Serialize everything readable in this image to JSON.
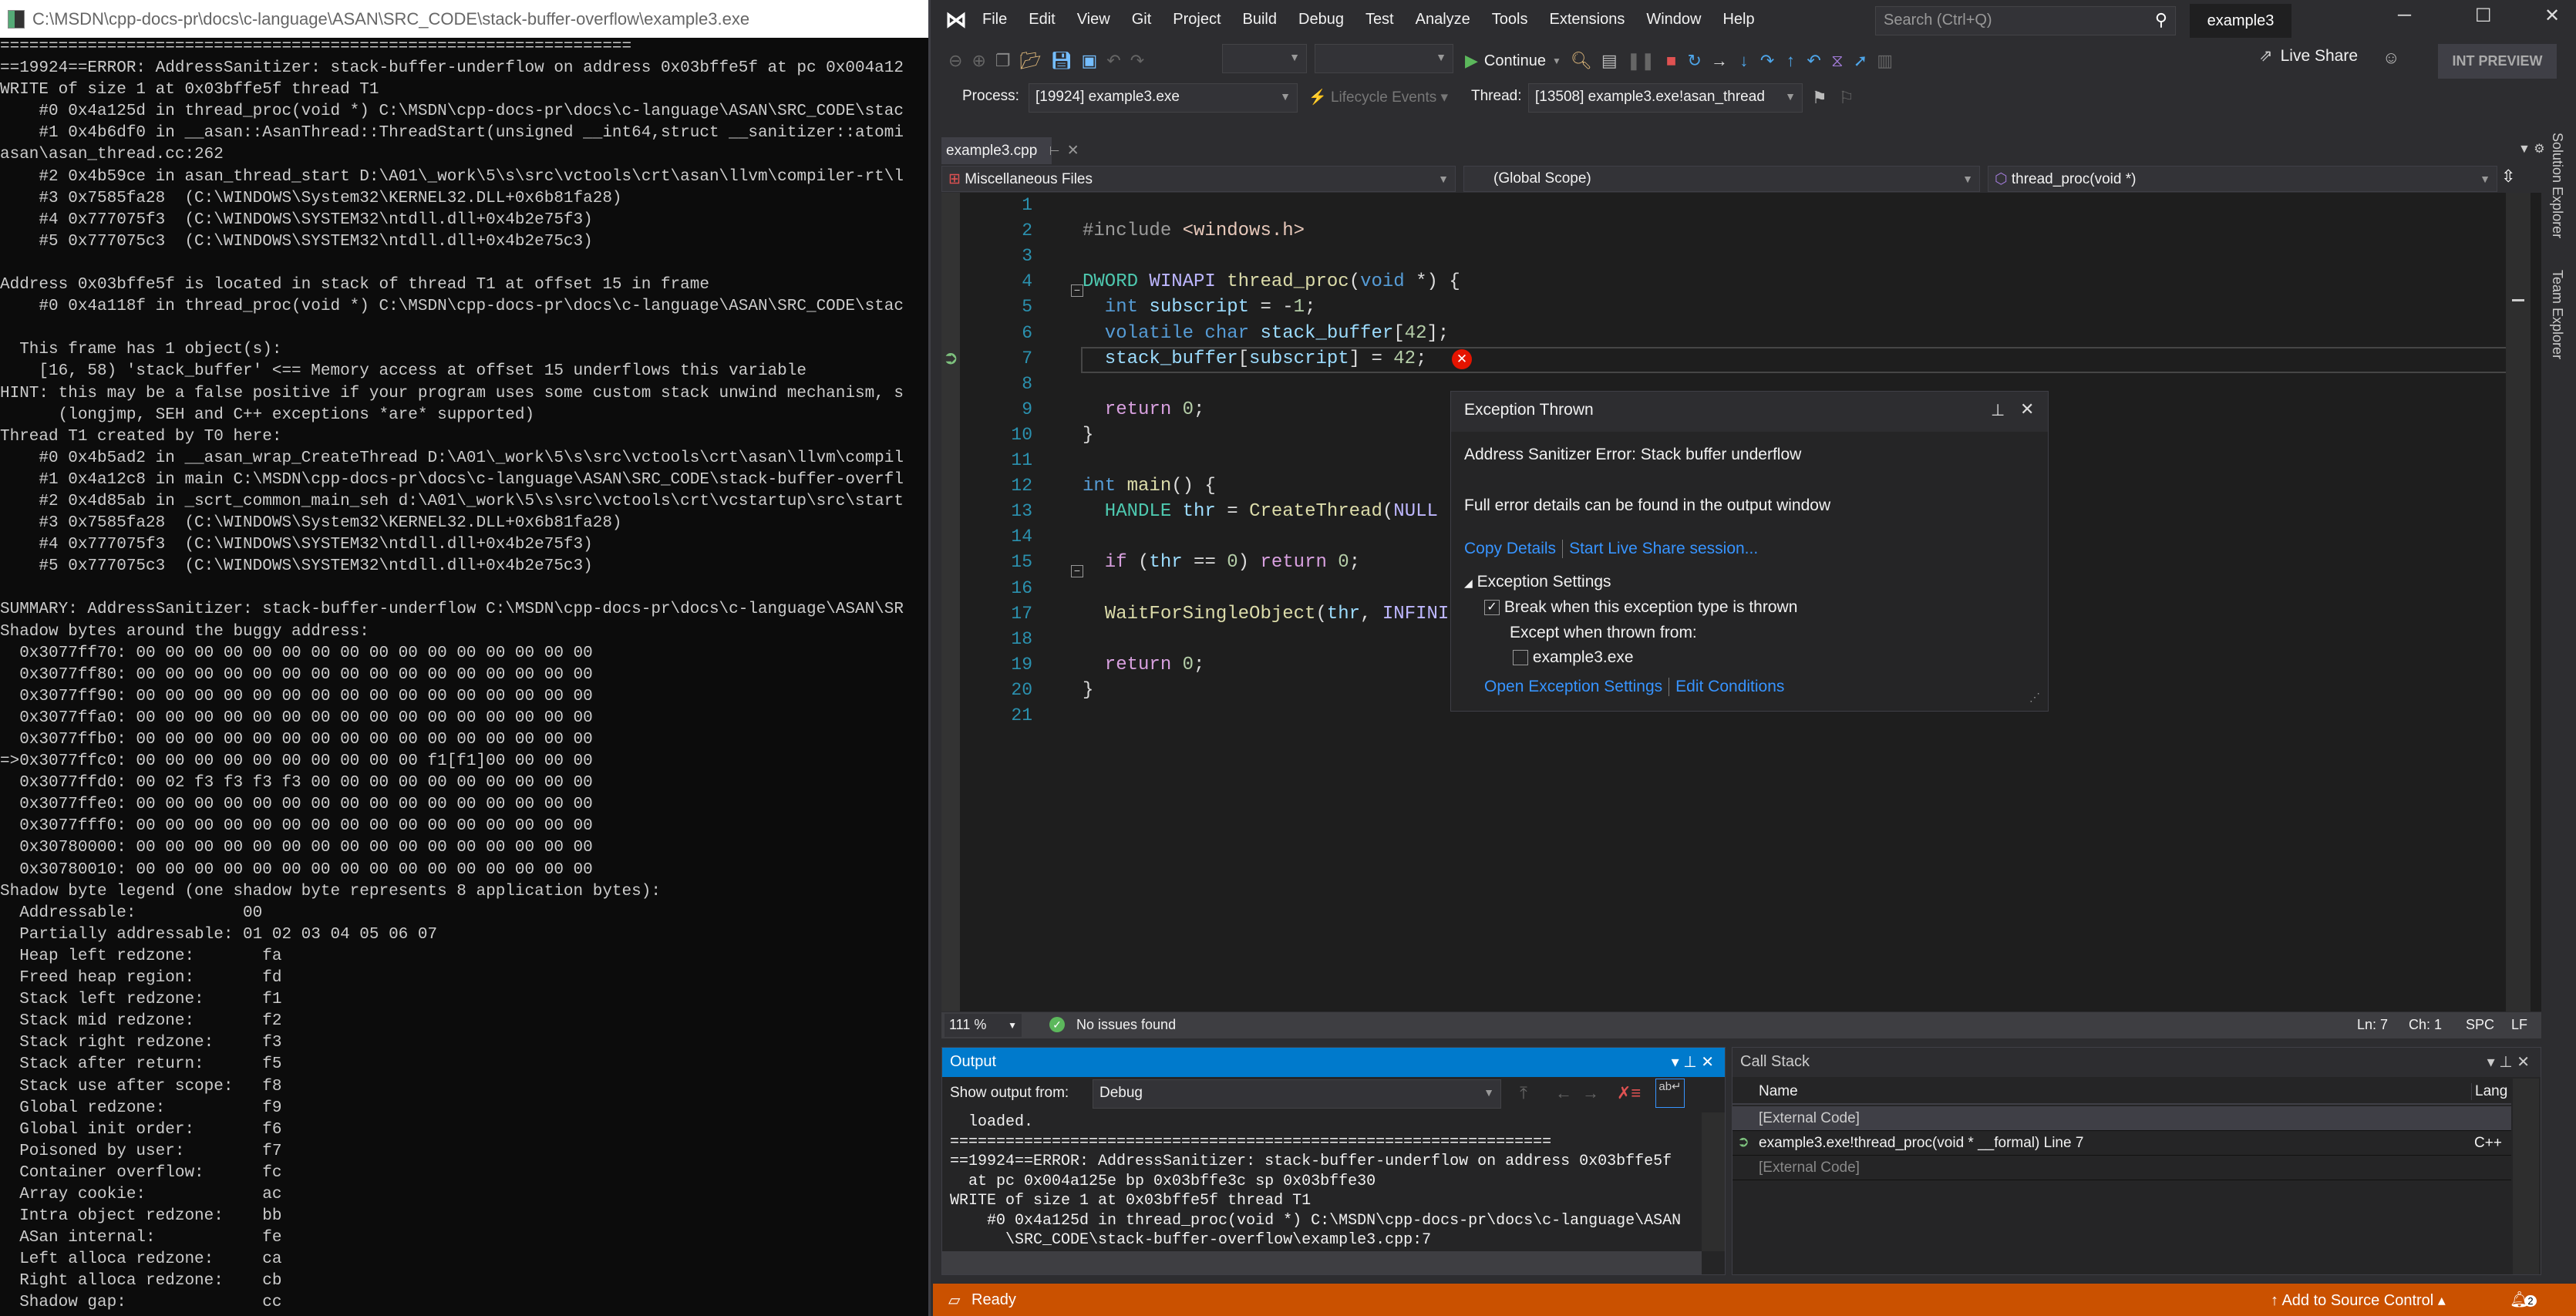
{
  "console": {
    "title": "C:\\MSDN\\cpp-docs-pr\\docs\\c-language\\ASAN\\SRC_CODE\\stack-buffer-overflow\\example3.exe",
    "lines": [
      "=================================================================",
      "==19924==ERROR: AddressSanitizer: stack-buffer-underflow on address 0x03bffe5f at pc 0x004a12",
      "WRITE of size 1 at 0x03bffe5f thread T1",
      "    #0 0x4a125d in thread_proc(void *) C:\\MSDN\\cpp-docs-pr\\docs\\c-language\\ASAN\\SRC_CODE\\stac",
      "    #1 0x4b6df0 in __asan::AsanThread::ThreadStart(unsigned __int64,struct __sanitizer::atomi",
      "asan\\asan_thread.cc:262",
      "    #2 0x4b59ce in asan_thread_start D:\\A01\\_work\\5\\s\\src\\vctools\\crt\\asan\\llvm\\compiler-rt\\l",
      "    #3 0x7585fa28  (C:\\WINDOWS\\System32\\KERNEL32.DLL+0x6b81fa28)",
      "    #4 0x777075f3  (C:\\WINDOWS\\SYSTEM32\\ntdll.dll+0x4b2e75f3)",
      "    #5 0x777075c3  (C:\\WINDOWS\\SYSTEM32\\ntdll.dll+0x4b2e75c3)",
      "",
      "Address 0x03bffe5f is located in stack of thread T1 at offset 15 in frame",
      "    #0 0x4a118f in thread_proc(void *) C:\\MSDN\\cpp-docs-pr\\docs\\c-language\\ASAN\\SRC_CODE\\stac",
      "",
      "  This frame has 1 object(s):",
      "    [16, 58) 'stack_buffer' <== Memory access at offset 15 underflows this variable",
      "HINT: this may be a false positive if your program uses some custom stack unwind mechanism, s",
      "      (longjmp, SEH and C++ exceptions *are* supported)",
      "Thread T1 created by T0 here:",
      "    #0 0x4b5ad2 in __asan_wrap_CreateThread D:\\A01\\_work\\5\\s\\src\\vctools\\crt\\asan\\llvm\\compil",
      "    #1 0x4a12c8 in main C:\\MSDN\\cpp-docs-pr\\docs\\c-language\\ASAN\\SRC_CODE\\stack-buffer-overfl",
      "    #2 0x4d85ab in _scrt_common_main_seh d:\\A01\\_work\\5\\s\\src\\vctools\\crt\\vcstartup\\src\\start",
      "    #3 0x7585fa28  (C:\\WINDOWS\\System32\\KERNEL32.DLL+0x6b81fa28)",
      "    #4 0x777075f3  (C:\\WINDOWS\\SYSTEM32\\ntdll.dll+0x4b2e75f3)",
      "    #5 0x777075c3  (C:\\WINDOWS\\SYSTEM32\\ntdll.dll+0x4b2e75c3)",
      "",
      "SUMMARY: AddressSanitizer: stack-buffer-underflow C:\\MSDN\\cpp-docs-pr\\docs\\c-language\\ASAN\\SR",
      "Shadow bytes around the buggy address:",
      "  0x3077ff70: 00 00 00 00 00 00 00 00 00 00 00 00 00 00 00 00",
      "  0x3077ff80: 00 00 00 00 00 00 00 00 00 00 00 00 00 00 00 00",
      "  0x3077ff90: 00 00 00 00 00 00 00 00 00 00 00 00 00 00 00 00",
      "  0x3077ffa0: 00 00 00 00 00 00 00 00 00 00 00 00 00 00 00 00",
      "  0x3077ffb0: 00 00 00 00 00 00 00 00 00 00 00 00 00 00 00 00",
      "=>0x3077ffc0: 00 00 00 00 00 00 00 00 00 00 f1[f1]00 00 00 00",
      "  0x3077ffd0: 00 02 f3 f3 f3 f3 00 00 00 00 00 00 00 00 00 00",
      "  0x3077ffe0: 00 00 00 00 00 00 00 00 00 00 00 00 00 00 00 00",
      "  0x3077fff0: 00 00 00 00 00 00 00 00 00 00 00 00 00 00 00 00",
      "  0x30780000: 00 00 00 00 00 00 00 00 00 00 00 00 00 00 00 00",
      "  0x30780010: 00 00 00 00 00 00 00 00 00 00 00 00 00 00 00 00",
      "Shadow byte legend (one shadow byte represents 8 application bytes):",
      "  Addressable:           00",
      "  Partially addressable: 01 02 03 04 05 06 07",
      "  Heap left redzone:       fa",
      "  Freed heap region:       fd",
      "  Stack left redzone:      f1",
      "  Stack mid redzone:       f2",
      "  Stack right redzone:     f3",
      "  Stack after return:      f5",
      "  Stack use after scope:   f8",
      "  Global redzone:          f9",
      "  Global init order:       f6",
      "  Poisoned by user:        f7",
      "  Container overflow:      fc",
      "  Array cookie:            ac",
      "  Intra object redzone:    bb",
      "  ASan internal:           fe",
      "  Left alloca redzone:     ca",
      "  Right alloca redzone:    cb",
      "  Shadow gap:              cc"
    ]
  },
  "vs": {
    "menu": [
      "File",
      "Edit",
      "View",
      "Git",
      "Project",
      "Build",
      "Debug",
      "Test",
      "Analyze",
      "Tools",
      "Extensions",
      "Window",
      "Help"
    ],
    "search_placeholder": "Search (Ctrl+Q)",
    "window_title": "example3",
    "toolbar": {
      "continue_label": "Continue",
      "live_share": "Live Share",
      "int_preview": "INT PREVIEW"
    },
    "debug_location": {
      "process_label": "Process:",
      "process_value": "[19924] example3.exe",
      "lifecycle_label": "Lifecycle Events",
      "thread_label": "Thread:",
      "thread_value": "[13508] example3.exe!asan_thread"
    },
    "doc_tab": "example3.cpp",
    "nav": {
      "project": "Miscellaneous Files",
      "scope": "(Global Scope)",
      "member": "thread_proc(void *)"
    },
    "side_tabs": [
      "Solution Explorer",
      "Team Explorer"
    ],
    "accent": "#007acc",
    "status_color": "#ca5100"
  },
  "editor": {
    "line_numbers": [
      "1",
      "2",
      "3",
      "4",
      "5",
      "6",
      "7",
      "8",
      "9",
      "10",
      "11",
      "12",
      "13",
      "14",
      "15",
      "16",
      "17",
      "18",
      "19",
      "20",
      "21"
    ],
    "current_line": 7,
    "lines": [
      [],
      [
        {
          "t": "#include ",
          "k": "pp"
        },
        {
          "t": "<windows.h>",
          "k": "str"
        }
      ],
      [],
      [
        {
          "t": "DWORD ",
          "k": "ty"
        },
        {
          "t": "WINAPI ",
          "k": "mac"
        },
        {
          "t": "thread_proc",
          "k": "fn"
        },
        {
          "t": "(",
          "k": "p"
        },
        {
          "t": "void",
          "k": "kw"
        },
        {
          "t": " *) {",
          "k": "p"
        }
      ],
      [
        {
          "t": "  int ",
          "k": "kw"
        },
        {
          "t": "subscript",
          "k": "var"
        },
        {
          "t": " = -",
          "k": "p"
        },
        {
          "t": "1",
          "k": "num"
        },
        {
          "t": ";",
          "k": "p"
        }
      ],
      [
        {
          "t": "  volatile char ",
          "k": "kw"
        },
        {
          "t": "stack_buffer",
          "k": "var"
        },
        {
          "t": "[",
          "k": "p"
        },
        {
          "t": "42",
          "k": "num"
        },
        {
          "t": "];",
          "k": "p"
        }
      ],
      [
        {
          "t": "  stack_buffer",
          "k": "var"
        },
        {
          "t": "[",
          "k": "p"
        },
        {
          "t": "subscript",
          "k": "var"
        },
        {
          "t": "] = ",
          "k": "p"
        },
        {
          "t": "42",
          "k": "num"
        },
        {
          "t": ";",
          "k": "p"
        }
      ],
      [],
      [
        {
          "t": "  return ",
          "k": "ctl"
        },
        {
          "t": "0",
          "k": "num"
        },
        {
          "t": ";",
          "k": "p"
        }
      ],
      [
        {
          "t": "}",
          "k": "p"
        }
      ],
      [],
      [
        {
          "t": "int ",
          "k": "kw"
        },
        {
          "t": "main",
          "k": "fn"
        },
        {
          "t": "() {",
          "k": "p"
        }
      ],
      [
        {
          "t": "  HANDLE ",
          "k": "ty"
        },
        {
          "t": "thr",
          "k": "var"
        },
        {
          "t": " = ",
          "k": "p"
        },
        {
          "t": "CreateThread",
          "k": "fn"
        },
        {
          "t": "(",
          "k": "p"
        },
        {
          "t": "NULL",
          "k": "mac"
        }
      ],
      [],
      [
        {
          "t": "  if ",
          "k": "ctl"
        },
        {
          "t": "(",
          "k": "p"
        },
        {
          "t": "thr",
          "k": "var"
        },
        {
          "t": " == ",
          "k": "p"
        },
        {
          "t": "0",
          "k": "num"
        },
        {
          "t": ") ",
          "k": "p"
        },
        {
          "t": "return ",
          "k": "ctl"
        },
        {
          "t": "0",
          "k": "num"
        },
        {
          "t": ";",
          "k": "p"
        }
      ],
      [],
      [
        {
          "t": "  WaitForSingleObject",
          "k": "fn"
        },
        {
          "t": "(",
          "k": "p"
        },
        {
          "t": "thr",
          "k": "var"
        },
        {
          "t": ", ",
          "k": "p"
        },
        {
          "t": "INFINI",
          "k": "mac"
        }
      ],
      [],
      [
        {
          "t": "  return ",
          "k": "ctl"
        },
        {
          "t": "0",
          "k": "num"
        },
        {
          "t": ";",
          "k": "p"
        }
      ],
      [
        {
          "t": "}",
          "k": "p"
        }
      ],
      []
    ]
  },
  "exception_popup": {
    "title": "Exception Thrown",
    "message": "Address Sanitizer Error: Stack buffer underflow",
    "detail": "Full error details can be found in the output window",
    "copy_details": "Copy Details",
    "live_share": "Start Live Share session...",
    "settings_header": "Exception Settings",
    "break_label": "Break when this exception type is thrown",
    "break_checked": true,
    "except_label": "Except when thrown from:",
    "module_label": "example3.exe",
    "module_checked": false,
    "open_settings": "Open Exception Settings",
    "edit_conditions": "Edit Conditions"
  },
  "editor_status": {
    "zoom": "111 %",
    "issues": "No issues found",
    "ln": "Ln: 7",
    "ch": "Ch: 1",
    "spc": "SPC",
    "lf": "LF"
  },
  "output": {
    "title": "Output",
    "show_from_label": "Show output from:",
    "source": "Debug",
    "lines": [
      "  loaded.",
      "=================================================================",
      "==19924==ERROR: AddressSanitizer: stack-buffer-underflow on address 0x03bffe5f",
      "  at pc 0x004a125e bp 0x03bffe3c sp 0x03bffe30",
      "WRITE of size 1 at 0x03bffe5f thread T1",
      "    #0 0x4a125d in thread_proc(void *) C:\\MSDN\\cpp-docs-pr\\docs\\c-language\\ASAN",
      "      \\SRC_CODE\\stack-buffer-overflow\\example3.cpp:7"
    ]
  },
  "call_stack": {
    "title": "Call Stack",
    "columns": [
      "Name",
      "Lang"
    ],
    "rows": [
      {
        "name": "[External Code]",
        "lang": ""
      },
      {
        "name": "example3.exe!thread_proc(void * __formal) Line 7",
        "lang": "C++"
      },
      {
        "name": "[External Code]",
        "lang": ""
      }
    ]
  },
  "statusbar": {
    "ready": "Ready",
    "source_control": "Add to Source Control",
    "notifications": "2"
  }
}
